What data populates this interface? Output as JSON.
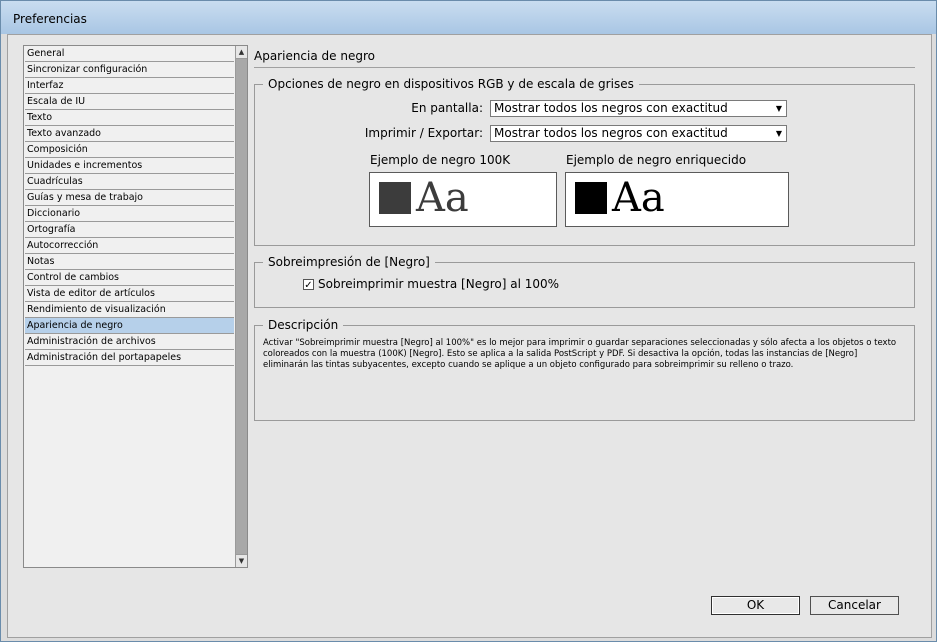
{
  "window": {
    "title": "Preferencias"
  },
  "sidebar": {
    "items": [
      {
        "label": "General"
      },
      {
        "label": "Sincronizar configuración"
      },
      {
        "label": "Interfaz"
      },
      {
        "label": "Escala de IU"
      },
      {
        "label": "Texto"
      },
      {
        "label": "Texto avanzado"
      },
      {
        "label": "Composición"
      },
      {
        "label": "Unidades e incrementos"
      },
      {
        "label": "Cuadrículas"
      },
      {
        "label": "Guías y mesa de trabajo"
      },
      {
        "label": "Diccionario"
      },
      {
        "label": "Ortografía"
      },
      {
        "label": "Autocorrección"
      },
      {
        "label": "Notas"
      },
      {
        "label": "Control de cambios"
      },
      {
        "label": "Vista de editor de artículos"
      },
      {
        "label": "Rendimiento de visualización"
      },
      {
        "label": "Apariencia de negro"
      },
      {
        "label": "Administración de archivos"
      },
      {
        "label": "Administración del portapapeles"
      }
    ],
    "selected_index": 17
  },
  "panel": {
    "title": "Apariencia de negro",
    "rgb_group": {
      "label": "Opciones de negro en dispositivos RGB y de escala de grises",
      "on_screen_label": "En pantalla:",
      "on_screen_value": "Mostrar todos los negros con exactitud",
      "print_label": "Imprimir / Exportar:",
      "print_value": "Mostrar todos los negros con exactitud",
      "sample1_caption": "Ejemplo de negro 100K",
      "sample2_caption": "Ejemplo de negro enriquecido",
      "sample_text": "Aa",
      "sample1_color": "#3c3c3c",
      "sample2_color": "#000000"
    },
    "overprint_group": {
      "label": "Sobreimpresión de [Negro]",
      "checkbox_label": "Sobreimprimir muestra [Negro] al 100%",
      "checked": true,
      "check_mark": "✓"
    },
    "description_group": {
      "label": "Descripción",
      "text": "Activar \"Sobreimprimir muestra [Negro] al 100%\" es lo mejor para imprimir o guardar separaciones seleccionadas y sólo afecta a los objetos o texto coloreados con la muestra (100K) [Negro]. Esto se aplica a la salida PostScript y PDF. Si desactiva la opción, todas las instancias de [Negro] eliminarán las tintas subyacentes, excepto cuando se aplique a un objeto configurado para sobreimprimir su relleno o trazo."
    }
  },
  "buttons": {
    "ok": "OK",
    "cancel": "Cancelar"
  },
  "icons": {
    "scroll_up": "▲",
    "scroll_down": "▼",
    "dropdown": "▼"
  }
}
